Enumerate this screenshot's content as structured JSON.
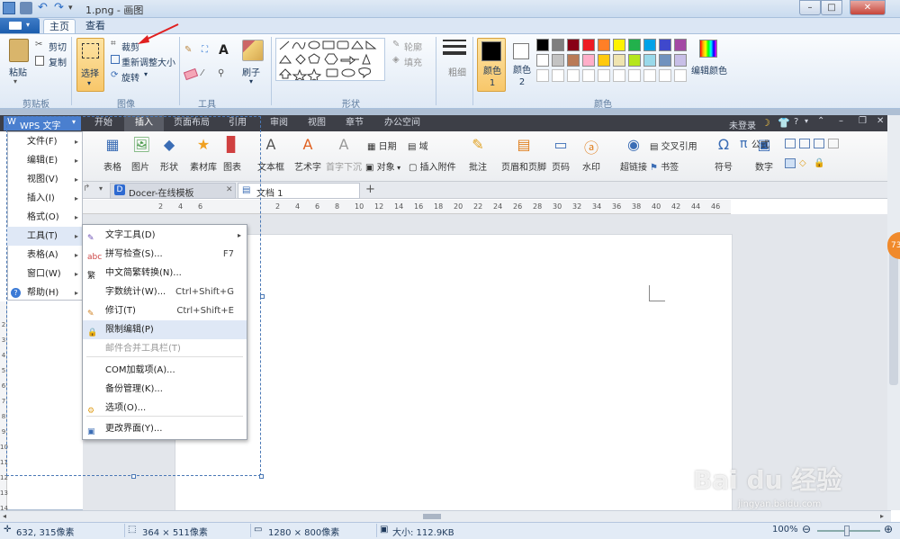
{
  "title_bar": {
    "title": "1.png - 画图"
  },
  "ribbon_tabs": [
    "主页",
    "查看"
  ],
  "clipboard": {
    "paste": "粘贴",
    "cut": "剪切",
    "copy": "复制",
    "group": "剪贴板"
  },
  "image": {
    "select": "选择",
    "crop": "裁剪",
    "resize": "重新调整大小",
    "rotate": "旋转",
    "group": "图像"
  },
  "tools": {
    "group": "工具"
  },
  "brushes": {
    "label": "刷子"
  },
  "shapes": {
    "outline": "轮廓",
    "fill": "填充",
    "group": "形状"
  },
  "size": {
    "label": "粗细"
  },
  "colors": {
    "color1": "颜色 1",
    "color2": "颜色 2",
    "edit": "编辑颜色",
    "group": "颜色",
    "palette_row1": [
      "#000000",
      "#7f7f7f",
      "#880015",
      "#ed1c24",
      "#ff7f27",
      "#fff200",
      "#22b14c",
      "#00a2e8",
      "#3f48cc",
      "#a349a4"
    ],
    "palette_row2": [
      "#ffffff",
      "#c3c3c3",
      "#b97a57",
      "#ffaec9",
      "#ffc90e",
      "#efe4b0",
      "#b5e61d",
      "#99d9ea",
      "#7092be",
      "#c8bfe7"
    ]
  },
  "wps": {
    "logo": "WPS 文字",
    "tabs": [
      "开始",
      "插入",
      "页面布局",
      "引用",
      "审阅",
      "视图",
      "章节",
      "办公空间"
    ],
    "active_tab": "插入",
    "login": "未登录",
    "toolbar": [
      "表格",
      "图片",
      "形状",
      "素材库",
      "图表",
      "文本框",
      "艺术字",
      "首字下沉",
      "批注",
      "页眉和页脚",
      "页码",
      "水印",
      "超链接",
      "符号",
      "数字"
    ],
    "toolbar_small": {
      "date": "日期",
      "field": "域",
      "object": "对象",
      "attach": "插入附件",
      "crossref": "交叉引用",
      "bookmark": "书签",
      "formula": "公式"
    },
    "doc_tabs": [
      "Docer-在线模板",
      "文档 1"
    ],
    "ruler": [
      "6",
      "4",
      "2",
      "2",
      "4",
      "6",
      "8",
      "10",
      "12",
      "14",
      "16",
      "18",
      "20",
      "22",
      "24",
      "26",
      "28",
      "30",
      "32",
      "34",
      "36",
      "38",
      "40",
      "42",
      "44",
      "46"
    ],
    "vruler": [
      "2",
      "3",
      "4",
      "5",
      "6",
      "7",
      "8",
      "9",
      "10",
      "11",
      "12",
      "13",
      "14"
    ],
    "main_menu": [
      {
        "label": "文件(F)"
      },
      {
        "label": "编辑(E)"
      },
      {
        "label": "视图(V)"
      },
      {
        "label": "插入(I)"
      },
      {
        "label": "格式(O)"
      },
      {
        "label": "工具(T)"
      },
      {
        "label": "表格(A)"
      },
      {
        "label": "窗口(W)"
      },
      {
        "label": "帮助(H)"
      }
    ],
    "tools_menu": [
      {
        "label": "文字工具(D)",
        "shortcut": ""
      },
      {
        "label": "拼写检查(S)...",
        "shortcut": "F7"
      },
      {
        "label": "中文简繁转换(N)...",
        "shortcut": ""
      },
      {
        "label": "字数统计(W)...",
        "shortcut": "Ctrl+Shift+G"
      },
      {
        "label": "修订(T)",
        "shortcut": "Ctrl+Shift+E"
      },
      {
        "label": "限制编辑(P)",
        "shortcut": ""
      },
      {
        "label": "邮件合并工具栏(T)",
        "shortcut": ""
      },
      {
        "label": "COM加载项(A)...",
        "shortcut": ""
      },
      {
        "label": "备份管理(K)...",
        "shortcut": ""
      },
      {
        "label": "选项(O)...",
        "shortcut": ""
      },
      {
        "label": "更改界面(Y)...",
        "shortcut": ""
      }
    ]
  },
  "status": {
    "cursor": "632, 315像素",
    "selection": "364 × 511像素",
    "canvas": "1280 × 800像素",
    "filesize": "大小: 112.9KB",
    "zoom": "100%"
  },
  "watermark": {
    "brand": "Bai du 经验",
    "url": "jingyan.baidu.com"
  },
  "side_badge": "73"
}
